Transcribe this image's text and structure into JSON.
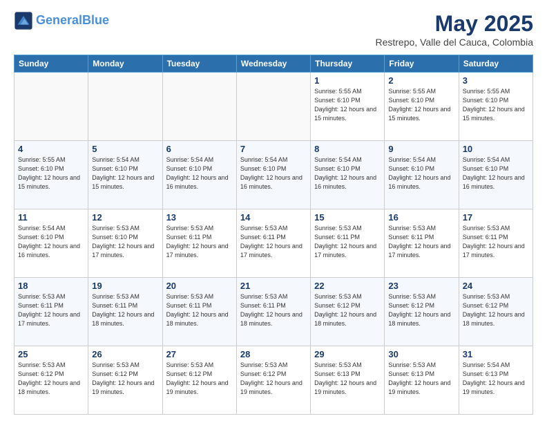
{
  "header": {
    "logo_line1": "General",
    "logo_line2": "Blue",
    "title": "May 2025",
    "subtitle": "Restrepo, Valle del Cauca, Colombia"
  },
  "days_of_week": [
    "Sunday",
    "Monday",
    "Tuesday",
    "Wednesday",
    "Thursday",
    "Friday",
    "Saturday"
  ],
  "weeks": [
    [
      {
        "day": null
      },
      {
        "day": null
      },
      {
        "day": null
      },
      {
        "day": null
      },
      {
        "day": 1,
        "sunrise": "5:55 AM",
        "sunset": "6:10 PM",
        "daylight": "12 hours and 15 minutes."
      },
      {
        "day": 2,
        "sunrise": "5:55 AM",
        "sunset": "6:10 PM",
        "daylight": "12 hours and 15 minutes."
      },
      {
        "day": 3,
        "sunrise": "5:55 AM",
        "sunset": "6:10 PM",
        "daylight": "12 hours and 15 minutes."
      }
    ],
    [
      {
        "day": 4,
        "sunrise": "5:55 AM",
        "sunset": "6:10 PM",
        "daylight": "12 hours and 15 minutes."
      },
      {
        "day": 5,
        "sunrise": "5:54 AM",
        "sunset": "6:10 PM",
        "daylight": "12 hours and 15 minutes."
      },
      {
        "day": 6,
        "sunrise": "5:54 AM",
        "sunset": "6:10 PM",
        "daylight": "12 hours and 16 minutes."
      },
      {
        "day": 7,
        "sunrise": "5:54 AM",
        "sunset": "6:10 PM",
        "daylight": "12 hours and 16 minutes."
      },
      {
        "day": 8,
        "sunrise": "5:54 AM",
        "sunset": "6:10 PM",
        "daylight": "12 hours and 16 minutes."
      },
      {
        "day": 9,
        "sunrise": "5:54 AM",
        "sunset": "6:10 PM",
        "daylight": "12 hours and 16 minutes."
      },
      {
        "day": 10,
        "sunrise": "5:54 AM",
        "sunset": "6:10 PM",
        "daylight": "12 hours and 16 minutes."
      }
    ],
    [
      {
        "day": 11,
        "sunrise": "5:54 AM",
        "sunset": "6:10 PM",
        "daylight": "12 hours and 16 minutes."
      },
      {
        "day": 12,
        "sunrise": "5:53 AM",
        "sunset": "6:10 PM",
        "daylight": "12 hours and 17 minutes."
      },
      {
        "day": 13,
        "sunrise": "5:53 AM",
        "sunset": "6:11 PM",
        "daylight": "12 hours and 17 minutes."
      },
      {
        "day": 14,
        "sunrise": "5:53 AM",
        "sunset": "6:11 PM",
        "daylight": "12 hours and 17 minutes."
      },
      {
        "day": 15,
        "sunrise": "5:53 AM",
        "sunset": "6:11 PM",
        "daylight": "12 hours and 17 minutes."
      },
      {
        "day": 16,
        "sunrise": "5:53 AM",
        "sunset": "6:11 PM",
        "daylight": "12 hours and 17 minutes."
      },
      {
        "day": 17,
        "sunrise": "5:53 AM",
        "sunset": "6:11 PM",
        "daylight": "12 hours and 17 minutes."
      }
    ],
    [
      {
        "day": 18,
        "sunrise": "5:53 AM",
        "sunset": "6:11 PM",
        "daylight": "12 hours and 17 minutes."
      },
      {
        "day": 19,
        "sunrise": "5:53 AM",
        "sunset": "6:11 PM",
        "daylight": "12 hours and 18 minutes."
      },
      {
        "day": 20,
        "sunrise": "5:53 AM",
        "sunset": "6:11 PM",
        "daylight": "12 hours and 18 minutes."
      },
      {
        "day": 21,
        "sunrise": "5:53 AM",
        "sunset": "6:11 PM",
        "daylight": "12 hours and 18 minutes."
      },
      {
        "day": 22,
        "sunrise": "5:53 AM",
        "sunset": "6:12 PM",
        "daylight": "12 hours and 18 minutes."
      },
      {
        "day": 23,
        "sunrise": "5:53 AM",
        "sunset": "6:12 PM",
        "daylight": "12 hours and 18 minutes."
      },
      {
        "day": 24,
        "sunrise": "5:53 AM",
        "sunset": "6:12 PM",
        "daylight": "12 hours and 18 minutes."
      }
    ],
    [
      {
        "day": 25,
        "sunrise": "5:53 AM",
        "sunset": "6:12 PM",
        "daylight": "12 hours and 18 minutes."
      },
      {
        "day": 26,
        "sunrise": "5:53 AM",
        "sunset": "6:12 PM",
        "daylight": "12 hours and 19 minutes."
      },
      {
        "day": 27,
        "sunrise": "5:53 AM",
        "sunset": "6:12 PM",
        "daylight": "12 hours and 19 minutes."
      },
      {
        "day": 28,
        "sunrise": "5:53 AM",
        "sunset": "6:12 PM",
        "daylight": "12 hours and 19 minutes."
      },
      {
        "day": 29,
        "sunrise": "5:53 AM",
        "sunset": "6:13 PM",
        "daylight": "12 hours and 19 minutes."
      },
      {
        "day": 30,
        "sunrise": "5:53 AM",
        "sunset": "6:13 PM",
        "daylight": "12 hours and 19 minutes."
      },
      {
        "day": 31,
        "sunrise": "5:54 AM",
        "sunset": "6:13 PM",
        "daylight": "12 hours and 19 minutes."
      }
    ]
  ]
}
